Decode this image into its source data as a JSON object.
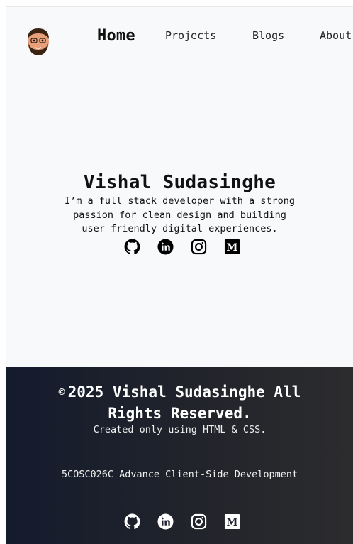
{
  "nav": {
    "home": "Home",
    "projects": "Projects",
    "blogs": "Blogs",
    "about": "About"
  },
  "hero": {
    "name": "Vishal Sudasinghe",
    "tagline": "I’m a full stack developer with a strong passion for clean design and building user friendly digital experiences.",
    "socials": [
      "github-icon",
      "linkedin-icon",
      "instagram-icon",
      "medium-icon"
    ]
  },
  "footer": {
    "copyright_symbol": "©",
    "copyright": "2025 Vishal Sudasinghe All Rights Reserved.",
    "created": "Created only using HTML & CSS.",
    "course": "5COSC026C Advance Client-Side Development",
    "socials": [
      "github-icon",
      "linkedin-icon",
      "instagram-icon",
      "medium-icon"
    ]
  },
  "colors": {
    "page_bg": "#f8f9fb",
    "footer_gradient_start": "#141b2d",
    "footer_gradient_end": "#2c2c2e",
    "text": "#111111"
  }
}
